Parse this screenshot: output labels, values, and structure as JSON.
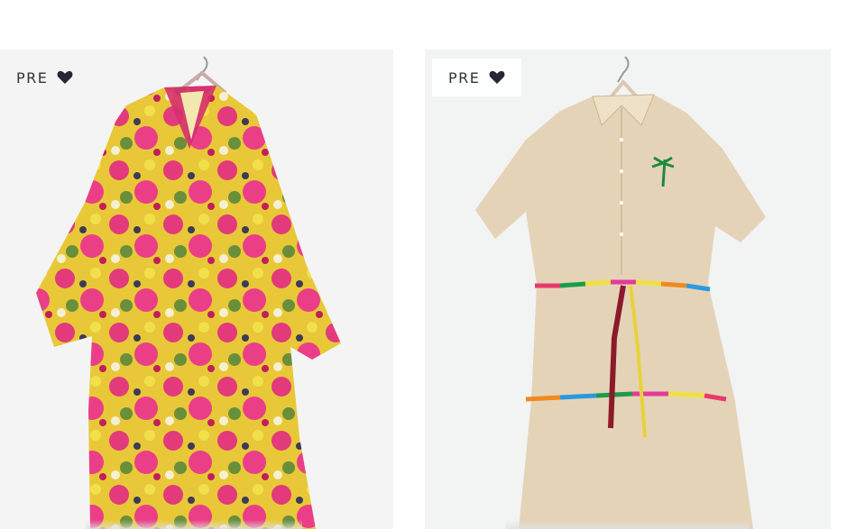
{
  "products": [
    {
      "badge_text": "PRE",
      "badge_icon": "heart-icon",
      "description_icon": "floral-kimono-dress-image"
    },
    {
      "badge_text": "PRE",
      "badge_icon": "heart-icon",
      "description_icon": "beige-shirt-dress-image"
    }
  ],
  "colors": {
    "badge_text": "#333333",
    "heart": "#2b2433",
    "card_bg": "#f4f4f4"
  }
}
